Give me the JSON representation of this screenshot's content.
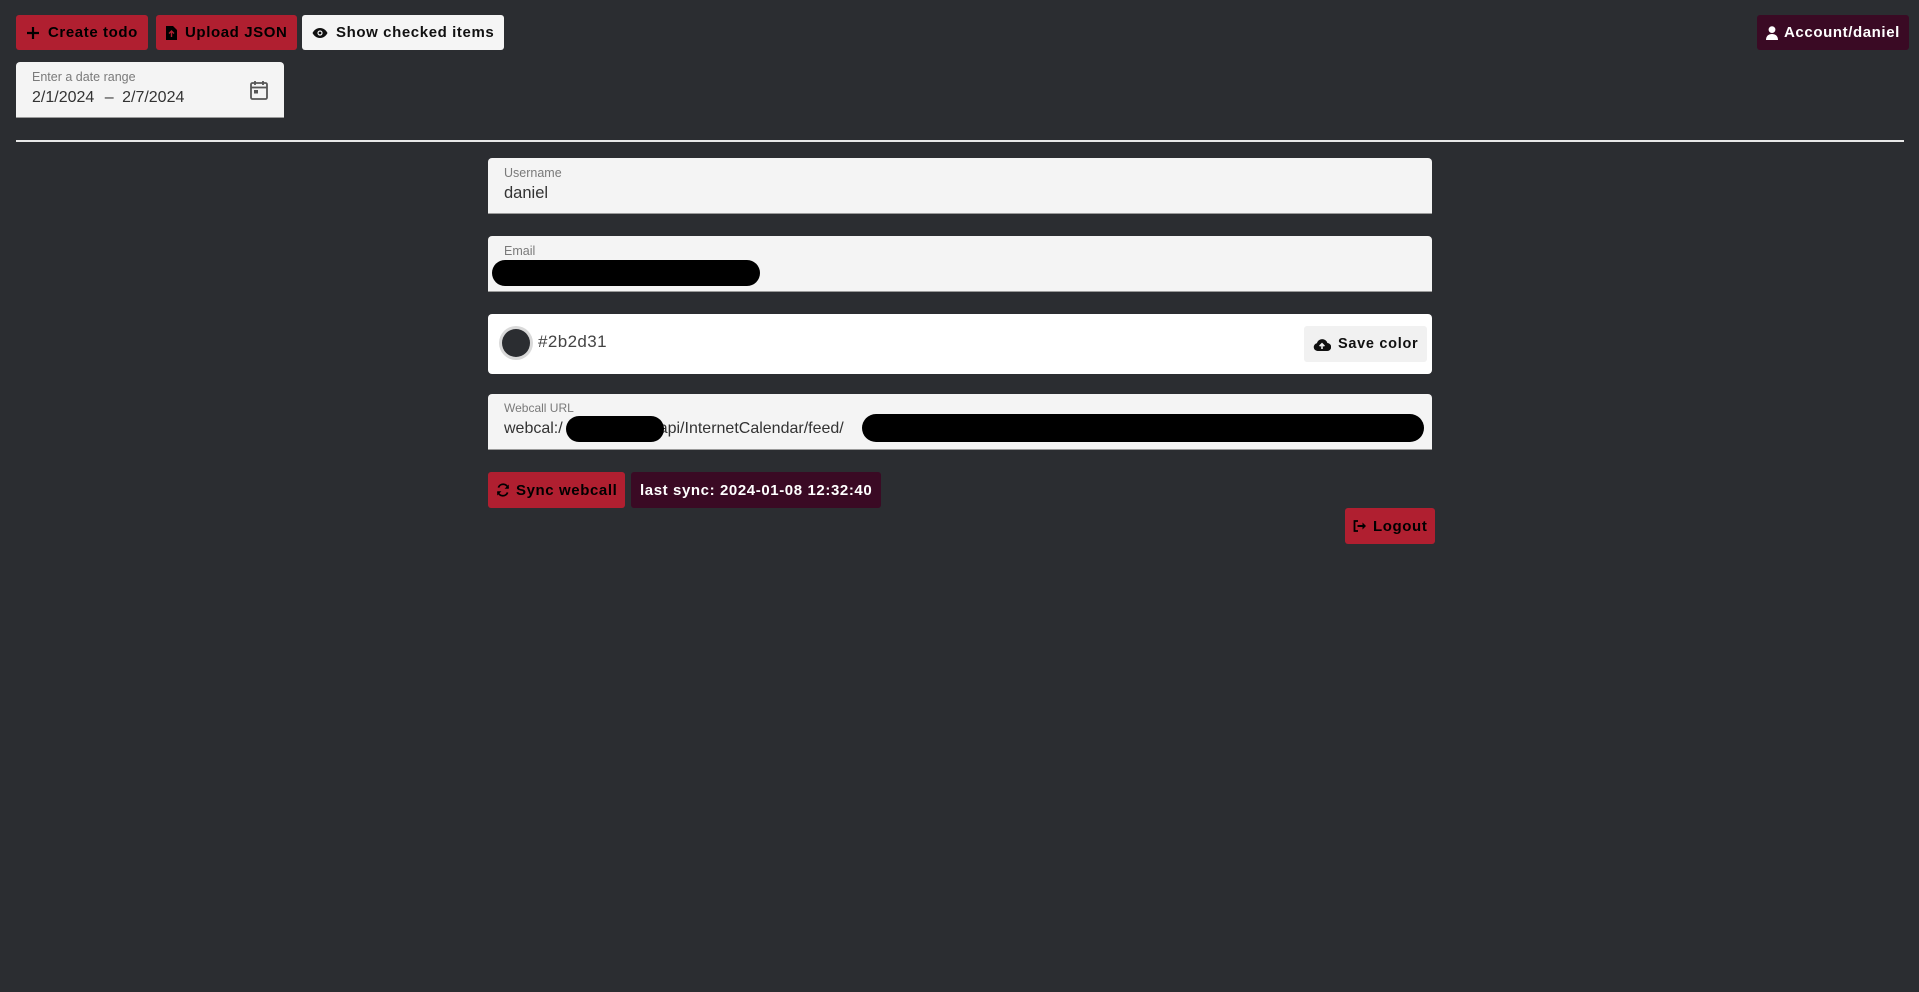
{
  "toolbar": {
    "create_todo": "Create todo",
    "upload_json": "Upload JSON",
    "show_checked": "Show checked items",
    "account": "Account/daniel"
  },
  "date_range": {
    "label": "Enter a date range",
    "start": "2/1/2024",
    "separator": "–",
    "end": "2/7/2024"
  },
  "account_form": {
    "username_label": "Username",
    "username_value": "daniel",
    "email_label": "Email",
    "email_value": "",
    "color_value": "#2b2d31",
    "save_color": "Save color",
    "webcall_label": "Webcall URL",
    "webcall_prefix": "webcal:/",
    "webcall_middle": "api/InternetCalendar/feed/",
    "sync_webcall": "Sync webcall",
    "last_sync": "last sync: 2024-01-08 12:32:40",
    "logout": "Logout"
  },
  "colors": {
    "background": "#2b2d31",
    "accent_red": "#b01f30",
    "accent_dark": "#3a0a24",
    "field_bg": "#f4f4f4"
  },
  "icons": {
    "create": "plus-icon",
    "upload": "file-upload-icon",
    "show": "eye-icon",
    "account": "user-icon",
    "calendar": "calendar-icon",
    "save_color": "cloud-upload-icon",
    "sync": "refresh-icon",
    "logout": "logout-icon"
  }
}
